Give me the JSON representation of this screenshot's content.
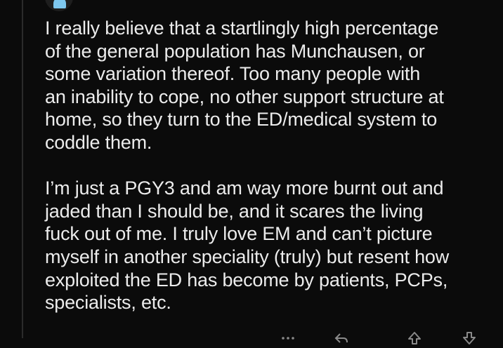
{
  "comment": {
    "paragraphs": [
      {
        "lines": [
          "I really believe that a startlingly high percentage",
          "of the general population has Munchausen, or",
          "some variation thereof. Too many people with",
          "an inability to cope, no other support structure at",
          "home, so they turn to the ED/medical system to",
          "coddle them."
        ]
      },
      {
        "lines": [
          "I’m just a PGY3 and am way more burnt out and",
          "jaded than I should be, and it scares the living",
          "fuck out of me. I truly love EM and can’t picture",
          "myself in another speciality (truly) but resent how",
          "exploited the ED has become by patients, PCPs,",
          "specialists, etc."
        ]
      }
    ]
  },
  "icons": {
    "avatar": "user-avatar",
    "more": "more-options-icon",
    "reply": "reply-icon",
    "upvote": "upvote-icon",
    "downvote": "downvote-icon"
  },
  "colors": {
    "background": "#0b0b0b",
    "text": "#ececec",
    "thread_line": "#2b2b2b",
    "avatar_accent": "#7ec8ef",
    "icon": "#8a8a8a"
  }
}
